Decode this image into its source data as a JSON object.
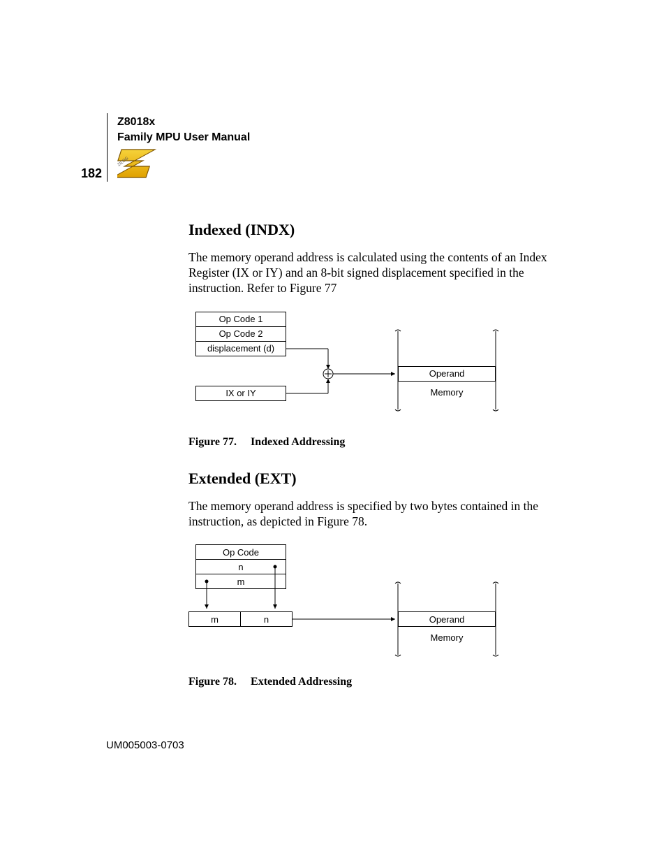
{
  "header": {
    "line1": "Z8018x",
    "line2": "Family MPU User Manual",
    "page_number": "182"
  },
  "section1": {
    "title": "Indexed (INDX)",
    "body": "The memory operand address is calculated using the contents of an Index Register (IX or IY) and an 8-bit signed displacement specified in the instruction. Refer to Figure 77",
    "fig": {
      "op1": "Op Code 1",
      "op2": "Op Code 2",
      "disp": "displacement (d)",
      "ixiy": "IX or IY",
      "operand": "Operand",
      "memory": "Memory"
    },
    "caption_num": "Figure 77.",
    "caption_title": "Indexed Addressing"
  },
  "section2": {
    "title": "Extended (EXT)",
    "body": "The memory operand address is specified by two bytes contained in the instruction, as depicted in Figure 78.",
    "fig": {
      "op": "Op Code",
      "n": "n",
      "m": "m",
      "operand": "Operand",
      "memory": "Memory"
    },
    "caption_num": "Figure 78.",
    "caption_title": "Extended Addressing"
  },
  "footer": "UM005003-0703"
}
